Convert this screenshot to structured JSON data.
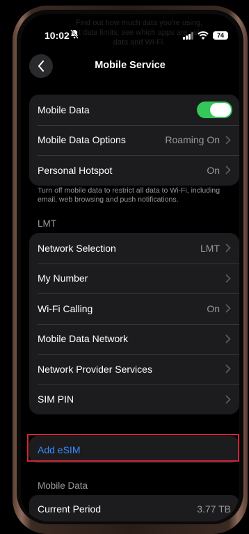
{
  "ghost_text": "Find out how much data you're using, set data limits, see which apps are using data and Wi-Fi.",
  "status": {
    "time": "10:02",
    "battery": "74"
  },
  "header": {
    "title": "Mobile Service"
  },
  "group1": {
    "mobile_data_label": "Mobile Data",
    "mobile_data_on": true,
    "options_label": "Mobile Data Options",
    "options_value": "Roaming On",
    "hotspot_label": "Personal Hotspot",
    "hotspot_value": "On"
  },
  "note": "Turn off mobile data to restrict all data to Wi-Fi, including email, web browsing and push notifications.",
  "carrier_section": "LMT",
  "group2": {
    "rows": [
      {
        "label": "Network Selection",
        "value": "LMT"
      },
      {
        "label": "My Number",
        "value": ""
      },
      {
        "label": "Wi-Fi Calling",
        "value": "On"
      },
      {
        "label": "Mobile Data Network",
        "value": ""
      },
      {
        "label": "Network Provider Services",
        "value": ""
      },
      {
        "label": "SIM PIN",
        "value": ""
      }
    ]
  },
  "esim": {
    "label": "Add eSIM"
  },
  "mobile_data_section": "Mobile Data",
  "current_period": {
    "label": "Current Period",
    "value": "3.77 TB"
  },
  "colors": {
    "toggle_on": "#34c759",
    "link": "#3a8cff",
    "highlight": "#d0243a"
  }
}
